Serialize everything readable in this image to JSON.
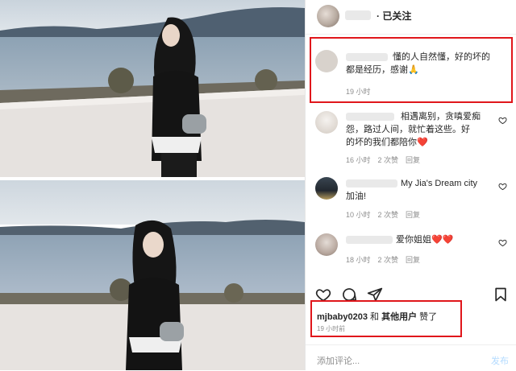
{
  "header": {
    "follow_status": "· 已关注"
  },
  "comments": [
    {
      "text_line1": "懂的人自然懂，好的坏的",
      "text_line2": "都是经历，感谢🙏",
      "time": "19 小时",
      "likes": "",
      "reply": ""
    },
    {
      "text_line1": "相遇离别，贪嗔爱痴",
      "text_line2": "怨，路过人间，就忙着这些。好",
      "text_line3": "的坏的我们都陪你❤️",
      "time": "16 小时",
      "likes": "2 次赞",
      "reply": "回复"
    },
    {
      "text_line1": "My Jia's Dream city",
      "text_line2": "加油!",
      "time": "10 小时",
      "likes": "2 次赞",
      "reply": "回复"
    },
    {
      "text_line1": "爱你姐姐❤️❤️",
      "time": "18 小时",
      "likes": "2 次赞",
      "reply": "回复"
    }
  ],
  "likes_line": {
    "user": "mjbaby0203",
    "and": "和",
    "others": "其他用户",
    "suffix": "赞了"
  },
  "likes_time": "19 小时前",
  "add_comment": {
    "placeholder": "添加评论...",
    "post": "发布"
  },
  "icons": [
    "heart-icon",
    "comment-icon",
    "share-icon",
    "bookmark-icon"
  ],
  "colors": {
    "highlight": "#e0161b",
    "heart_red": "#ed4956",
    "post_disabled": "#b3dbff"
  }
}
